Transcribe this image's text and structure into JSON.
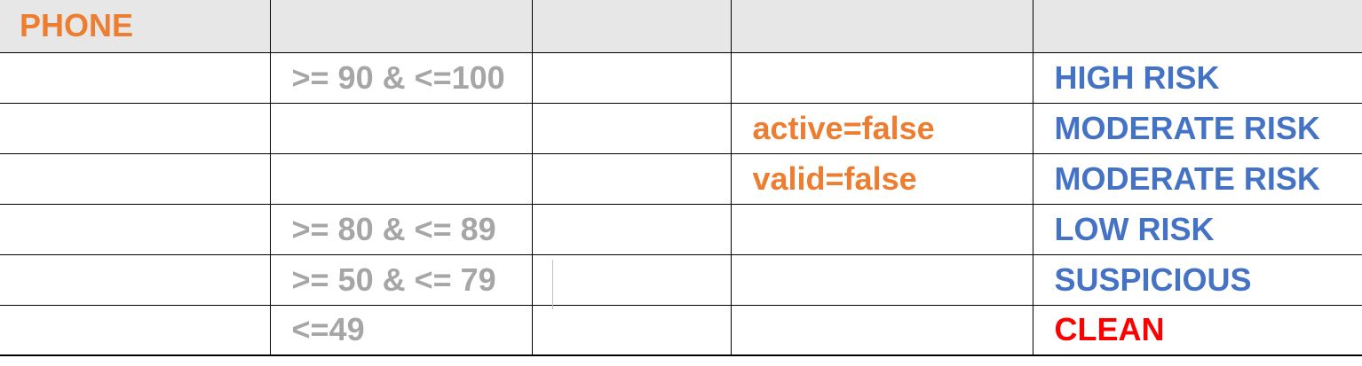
{
  "header": {
    "title": "PHONE",
    "title_color": "#ed7d31",
    "background_color": "#e7e7e7"
  },
  "colors": {
    "score": "#a6a6a6",
    "condition": "#ed7d31",
    "risk": "#4472c4",
    "clean": "#ff0000"
  },
  "rows": [
    {
      "score": ">= 90 & <=100",
      "condition": "",
      "result": "HIGH RISK"
    },
    {
      "score": "",
      "condition": "active=false",
      "result": "MODERATE RISK"
    },
    {
      "score": "",
      "condition": "valid=false",
      "result": "MODERATE RISK"
    },
    {
      "score": ">= 80 & <= 89",
      "condition": "",
      "result": "LOW RISK"
    },
    {
      "score": ">= 50 & <= 79",
      "condition": "",
      "result": "SUSPICIOUS"
    },
    {
      "score": "<=49",
      "condition": "",
      "result": "CLEAN"
    }
  ]
}
